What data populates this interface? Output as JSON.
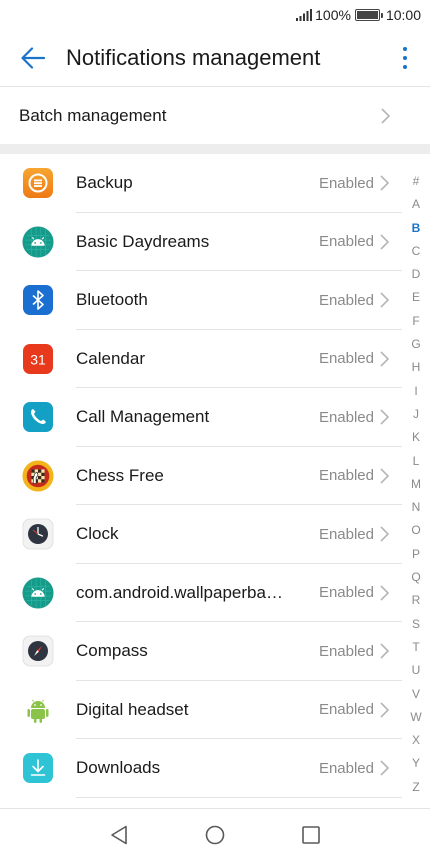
{
  "status_bar": {
    "battery": "100%",
    "time": "10:00",
    "battery_level": 1.0
  },
  "header": {
    "title": "Notifications management"
  },
  "batch": {
    "label": "Batch management"
  },
  "apps": [
    {
      "name": "Backup",
      "status": "Enabled",
      "icon": "backup-icon"
    },
    {
      "name": "Basic Daydreams",
      "status": "Enabled",
      "icon": "android-grid-icon"
    },
    {
      "name": "Bluetooth",
      "status": "Enabled",
      "icon": "bluetooth-icon"
    },
    {
      "name": "Calendar",
      "status": "Enabled",
      "icon": "calendar-icon",
      "icon_text": "31"
    },
    {
      "name": "Call Management",
      "status": "Enabled",
      "icon": "phone-icon"
    },
    {
      "name": "Chess Free",
      "status": "Enabled",
      "icon": "chess-icon"
    },
    {
      "name": "Clock",
      "status": "Enabled",
      "icon": "clock-icon"
    },
    {
      "name": "com.android.wallpaperba…",
      "status": "Enabled",
      "icon": "android-grid-icon"
    },
    {
      "name": "Compass",
      "status": "Enabled",
      "icon": "compass-icon"
    },
    {
      "name": "Digital headset",
      "status": "Enabled",
      "icon": "android-icon"
    },
    {
      "name": "Downloads",
      "status": "Enabled",
      "icon": "download-icon"
    }
  ],
  "index": [
    "#",
    "A",
    "B",
    "C",
    "D",
    "E",
    "F",
    "G",
    "H",
    "I",
    "J",
    "K",
    "L",
    "M",
    "N",
    "O",
    "P",
    "Q",
    "R",
    "S",
    "T",
    "U",
    "V",
    "W",
    "X",
    "Y",
    "Z"
  ],
  "index_active": "B",
  "colors": {
    "accent": "#1a73c9",
    "status_text": "#8a8a8a"
  }
}
